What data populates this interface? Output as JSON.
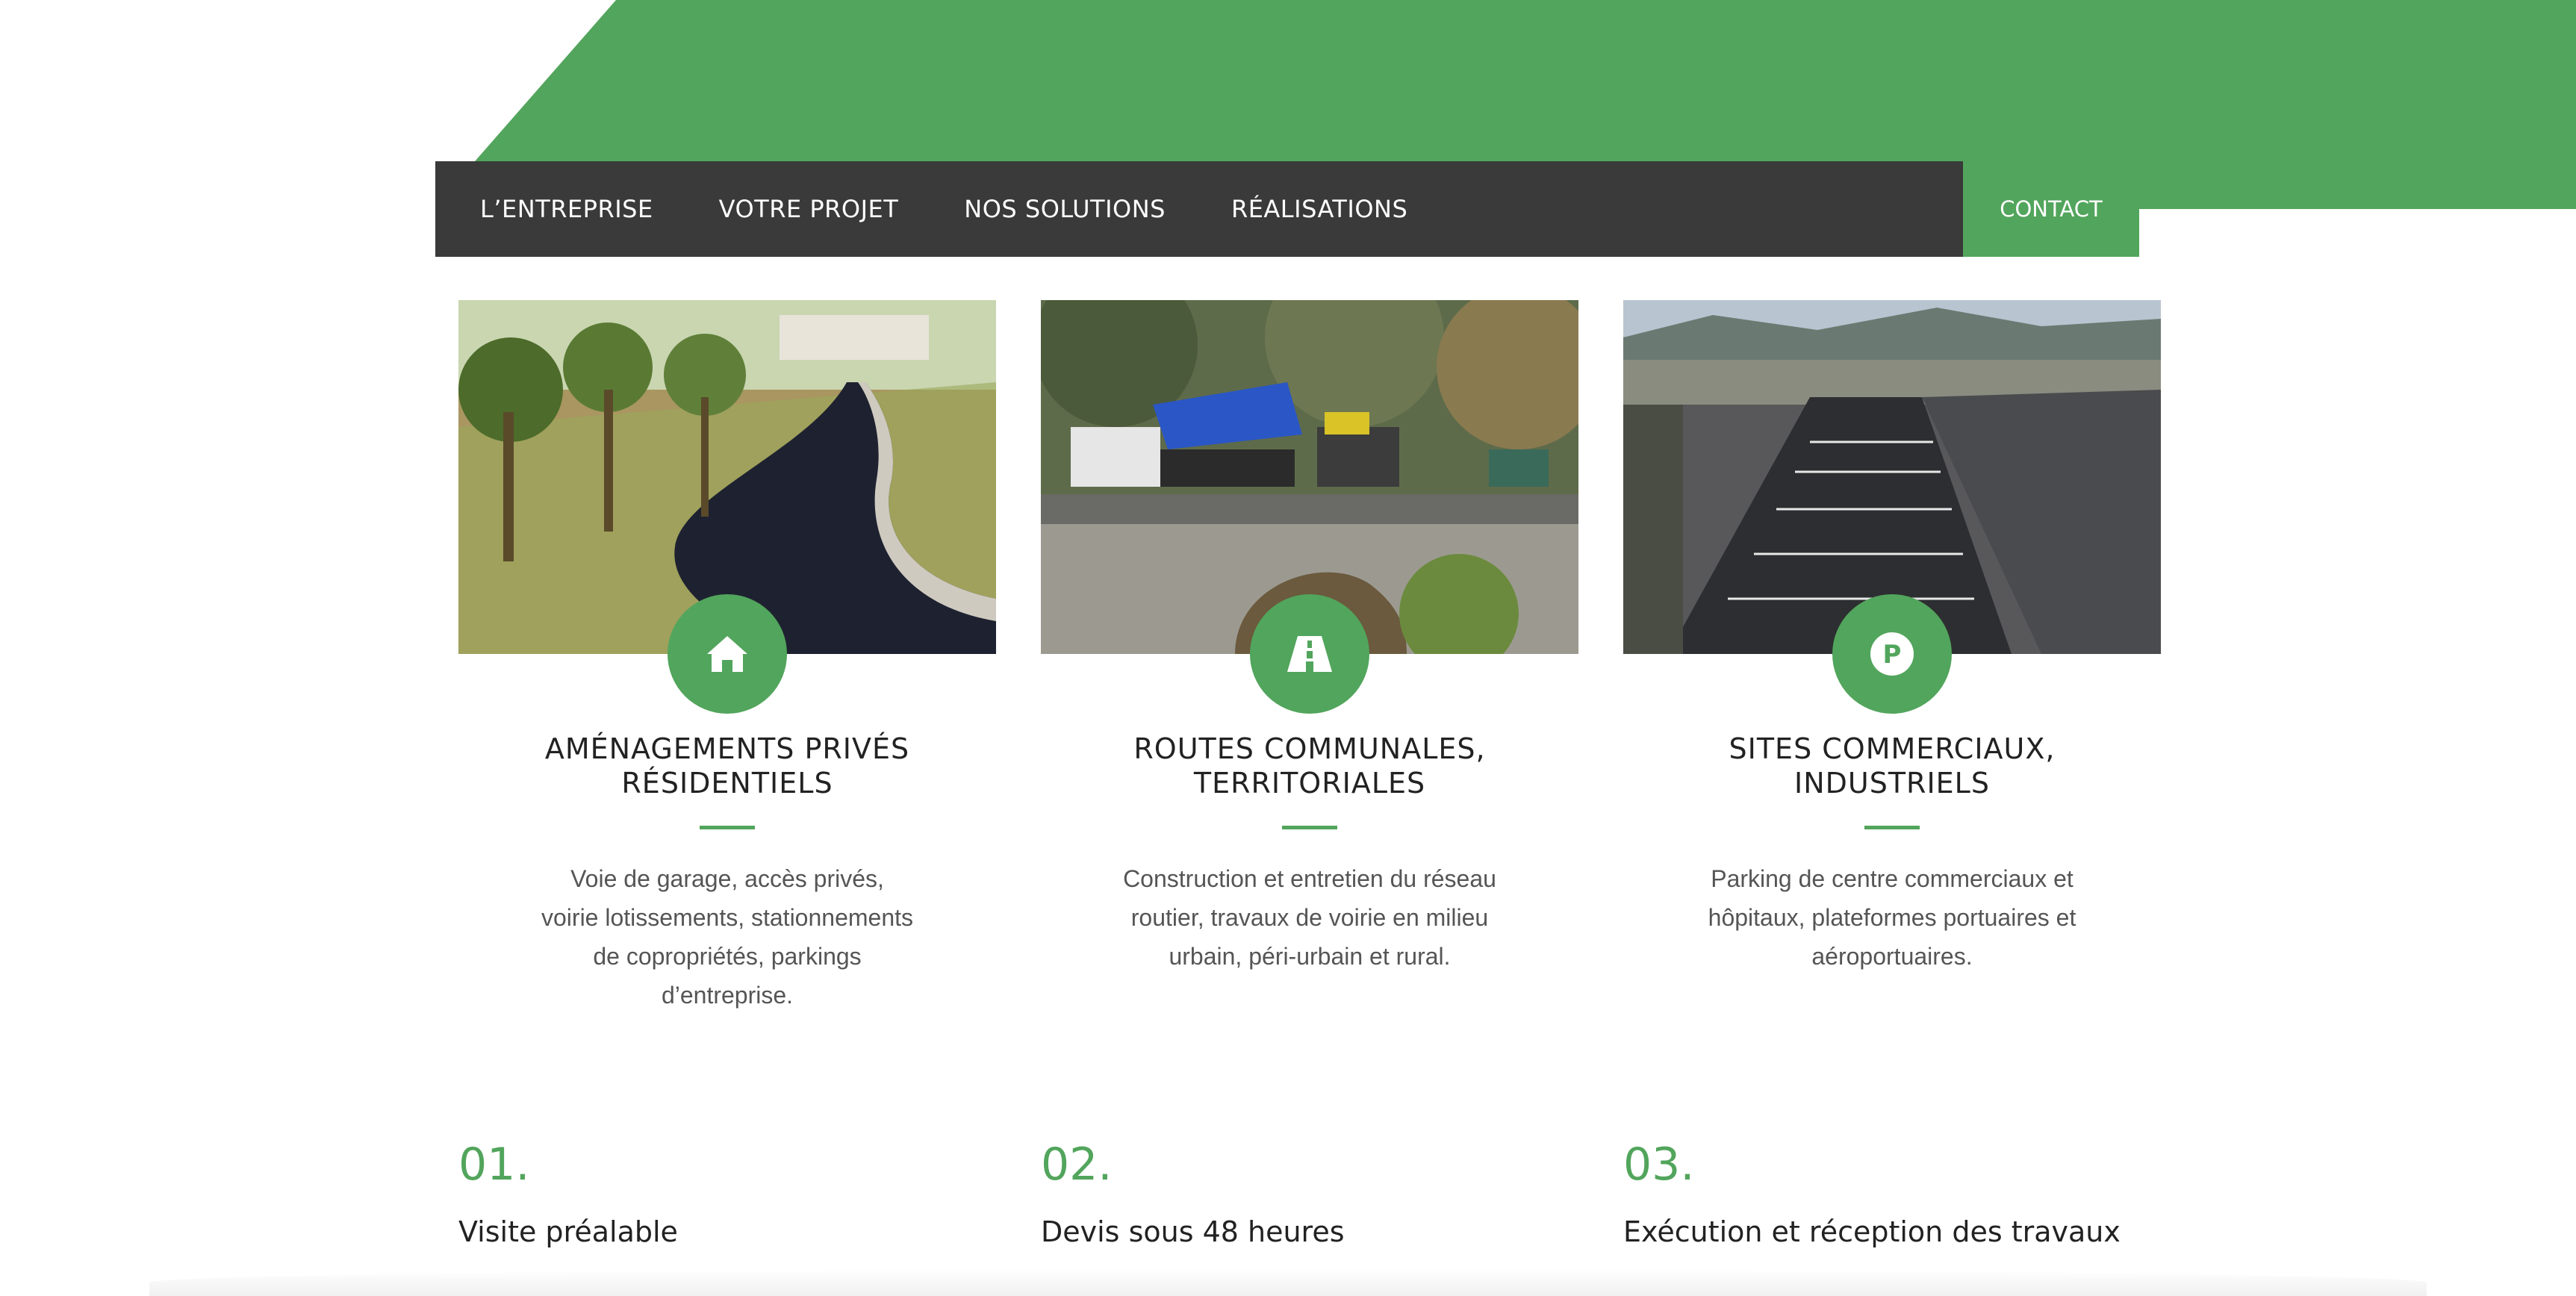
{
  "nav": {
    "items": [
      {
        "label": "L’ENTREPRISE"
      },
      {
        "label": "VOTRE PROJET"
      },
      {
        "label": "NOS SOLUTIONS"
      },
      {
        "label": "RÉALISATIONS"
      }
    ],
    "contact_label": "CONTACT"
  },
  "colors": {
    "accent": "#52a55c",
    "nav_bg": "#3a3a3a"
  },
  "cards": [
    {
      "icon": "home-icon",
      "title_line1": "AMÉNAGEMENTS PRIVÉS",
      "title_line2": "RÉSIDENTIELS",
      "text": "Voie de garage, accès privés, voirie lotissements, stationnements de copropriétés, parkings d’entreprise."
    },
    {
      "icon": "road-icon",
      "title_line1": "ROUTES COMMUNALES,",
      "title_line2": "TERRITORIALES",
      "text": "Construction et entretien du réseau routier, travaux de voirie en milieu urbain, péri-urbain et rural."
    },
    {
      "icon": "parking-icon",
      "title_line1": "SITES COMMERCIAUX,",
      "title_line2": "INDUSTRIELS",
      "text": "Parking de centre commerciaux et hôpitaux, plateformes portuaires et aéroportuaires."
    }
  ],
  "steps": [
    {
      "num": "01.",
      "title": "Visite préalable"
    },
    {
      "num": "02.",
      "title": "Devis sous 48 heures"
    },
    {
      "num": "03.",
      "title": "Exécution et réception des travaux"
    }
  ]
}
